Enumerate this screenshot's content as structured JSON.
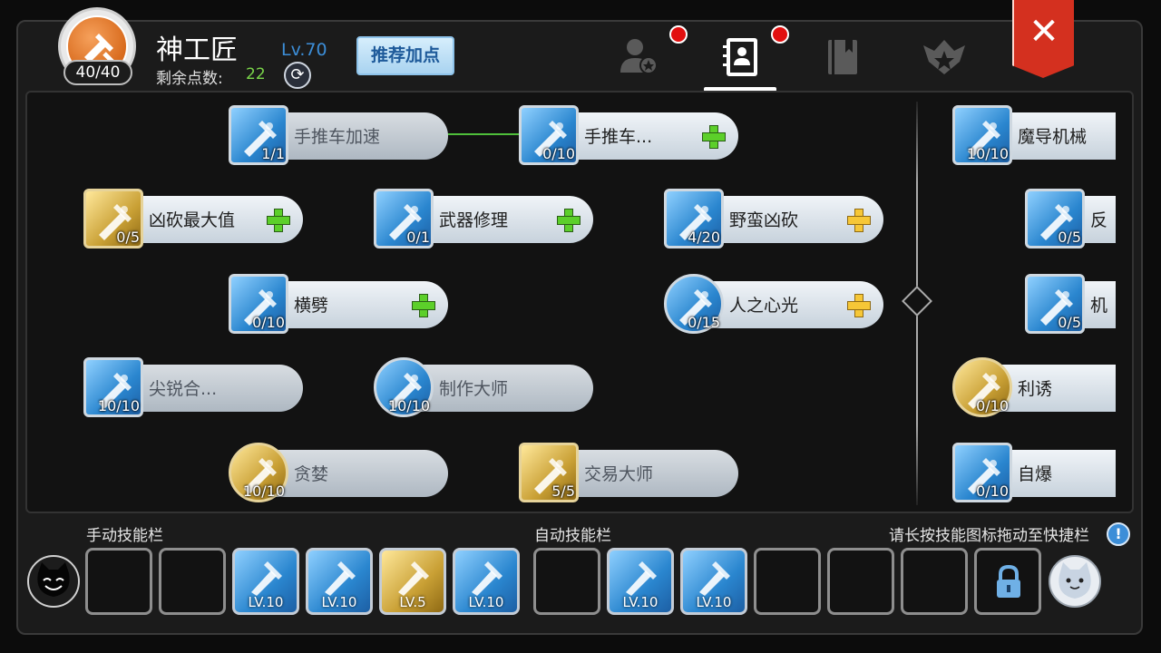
{
  "header": {
    "class_name": "神工匠",
    "profile_count": "40/40",
    "points_label": "剩余点数:",
    "points_value": "22",
    "level": "Lv.70",
    "recommend_label": "推荐加点"
  },
  "close_label": "✕",
  "tree": {
    "left": [
      {
        "name": "手推车加速",
        "level": "1/1",
        "plus": "",
        "style": "blue",
        "locked": true
      },
      {
        "name": "手推车...",
        "level": "0/10",
        "plus": "green",
        "style": "blue",
        "locked": false
      },
      {
        "name": "凶砍最大值",
        "level": "0/5",
        "plus": "green",
        "style": "gold",
        "locked": false
      },
      {
        "name": "武器修理",
        "level": "0/1",
        "plus": "green",
        "style": "blue",
        "locked": false
      },
      {
        "name": "野蛮凶砍",
        "level": "4/20",
        "plus": "yellow",
        "style": "blue",
        "locked": false
      },
      {
        "name": "横劈",
        "level": "0/10",
        "plus": "green",
        "style": "blue",
        "locked": false
      },
      {
        "name": "人之心光",
        "level": "0/15",
        "plus": "yellow",
        "style": "blue-round",
        "locked": false
      },
      {
        "name": "尖锐合...",
        "level": "10/10",
        "plus": "",
        "style": "blue",
        "locked": true
      },
      {
        "name": "制作大师",
        "level": "10/10",
        "plus": "",
        "style": "blue-round",
        "locked": true
      },
      {
        "name": "贪婪",
        "level": "10/10",
        "plus": "",
        "style": "gold-round",
        "locked": true
      },
      {
        "name": "交易大师",
        "level": "5/5",
        "plus": "",
        "style": "gold",
        "locked": true
      }
    ],
    "right": [
      {
        "name": "魔导机械",
        "level": "10/10"
      },
      {
        "name": "反",
        "level": "0/5"
      },
      {
        "name": "机",
        "level": "0/5"
      },
      {
        "name": "利诱",
        "level": "0/10"
      },
      {
        "name": "自爆",
        "level": "0/10"
      }
    ]
  },
  "bottom": {
    "manual_label": "手动技能栏",
    "auto_label": "自动技能栏",
    "hint": "请长按技能图标拖动至快捷栏",
    "manual_slots": [
      "",
      "",
      "LV.10",
      "LV.10",
      "LV.5",
      "LV.10"
    ],
    "auto_slots": [
      "",
      "LV.10",
      "LV.10",
      "",
      "",
      ""
    ]
  }
}
